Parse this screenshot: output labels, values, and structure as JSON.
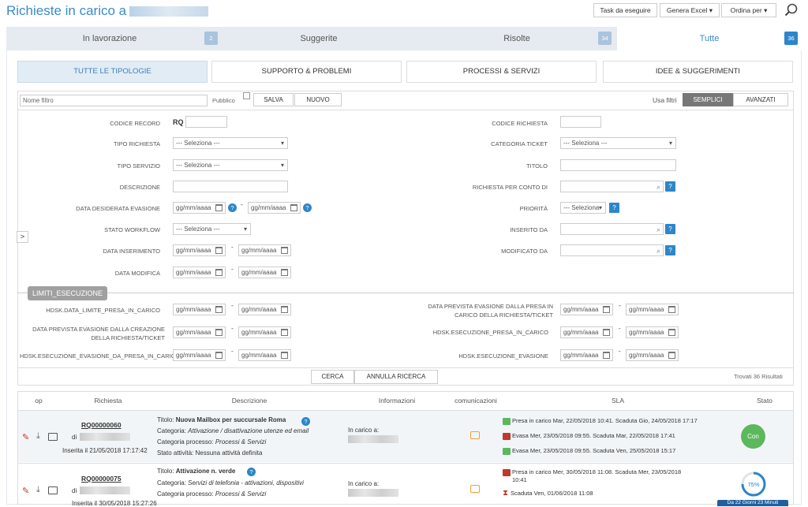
{
  "header": {
    "title": "Richieste in carico a",
    "btn_task": "Task da eseguire",
    "btn_excel": "Genera Excel",
    "btn_order": "Ordina per"
  },
  "tabs": [
    {
      "label": "In lavorazione",
      "count": "2"
    },
    {
      "label": "Suggerite",
      "count": ""
    },
    {
      "label": "Risolte",
      "count": "34"
    },
    {
      "label": "Tutte",
      "count": "36"
    }
  ],
  "types": [
    "TUTTE LE TIPOLOGIE",
    "SUPPORTO & PROBLEMI",
    "PROCESSI & SERVIZI",
    "IDEE & SUGGERIMENTI"
  ],
  "filter": {
    "name_placeholder": "Nome filtro",
    "pubblico": "Pubblico",
    "salva": "SALVA",
    "nuovo": "NUOVO",
    "usa_filtri": "Usa filtri",
    "semplici": "SEMPLICI",
    "avanzati": "AVANZATI",
    "codice_record": "CODICE RECORD",
    "rq": "RQ",
    "codice_richiesta": "CODICE RICHIESTA",
    "tipo_richiesta": "TIPO RICHIESTA",
    "categoria_ticket": "CATEGORIA TICKET",
    "tipo_servizio": "TIPO SERVIZIO",
    "titolo": "TITOLO",
    "descrizione": "DESCRIZIONE",
    "richiesta_per_conto_di": "RICHIESTA PER CONTO DI",
    "data_desiderata": "DATA DESIDERATA EVASIONE",
    "priorita": "PRIORITÀ",
    "stato_workflow": "STATO WORKFLOW",
    "inserito_da": "INSERITO DA",
    "data_inserimento": "DATA INSERIMENTO",
    "modificato_da": "MODIFICATO DA",
    "data_modifica": "DATA MODIFICA",
    "limiti": "LIMITI_ESECUZIONE",
    "hdsk_limite": "HDSK.DATA_LIMITE_PRESA_IN_CARICO",
    "prevista_presa": "DATA PREVISTA EVASIONE DALLA PRESA IN CARICO DELLA RICHIESTA/TICKET",
    "prevista_creazione": "DATA PREVISTA EVASIONE DALLA CREAZIONE DELLA RICHIESTA/TICKET",
    "hdsk_esec_presa": "HDSK.ESECUZIONE_PRESA_IN_CARICO",
    "hdsk_esec_da_presa": "HDSK.ESECUZIONE_EVASIONE_DA_PRESA_IN_CARICO",
    "hdsk_esec_evasione": "HDSK.ESECUZIONE_EVASIONE",
    "seleziona": "--- Seleziona ---",
    "seleziona_short": "--- Seleziona",
    "date_placeholder": "gg/mm/aaaa",
    "dash": "-",
    "cerca": "CERCA",
    "annulla": "ANNULLA RICERCA",
    "trovati": "Trovati 36 Risultati",
    "expand": ">"
  },
  "table": {
    "headers": [
      "op",
      "Richiesta",
      "Descrizione",
      "Informazioni",
      "comunicazioni",
      "SLA",
      "Stato"
    ],
    "rows": [
      {
        "code": "RQ00000060",
        "di": "di",
        "inserita": "Inserita il 21/05/2018 17:17:42",
        "titolo_label": "Titolo:",
        "titolo": "Nuova Mailbox per succursale Roma",
        "categoria_label": "Categoria:",
        "categoria": "Attivazione / disattivazione utenze ed email",
        "processo_label": "Categoria processo:",
        "processo": "Processi & Servizi",
        "stato_label": "Stato attività:",
        "stato_attivita": "Nessuna attività definita",
        "in_carico": "In carico a:",
        "sla": [
          "Presa in carico Mar, 22/05/2018 10:41. Scaduta Gio, 24/05/2018 17:17",
          "Evasa Mer, 23/05/2018 09:55. Scaduta Mar, 22/05/2018 17:41",
          "Evasa Mer, 23/05/2018 09:55. Scaduta Ven, 25/05/2018 15:17"
        ],
        "stato": "Con"
      },
      {
        "code": "RQ00000075",
        "di": "di",
        "inserita": "Inserita il 30/05/2018 15:27:26",
        "titolo_label": "Titolo:",
        "titolo": "Attivazione n. verde",
        "categoria_label": "Categoria:",
        "categoria": "Servizi di telefonia - attivazioni, dispositivi",
        "processo_label": "Categoria processo:",
        "processo": "Processi & Servizi",
        "in_carico": "In carico a:",
        "sla": [
          "Presa in carico Mer, 30/05/2018 11:08. Scaduta Mer, 23/05/2018",
          "10:41",
          "Scaduta Ven, 01/06/2018 11:08"
        ],
        "progress": "75%",
        "progress_value": 0.75,
        "stato_badge": "Da 22 Giorni 23 Minuti"
      }
    ]
  },
  "colors": {
    "accent": "#3a8bc8",
    "green": "#5cb85c",
    "red": "#c0392b",
    "orange": "#f0a030"
  }
}
